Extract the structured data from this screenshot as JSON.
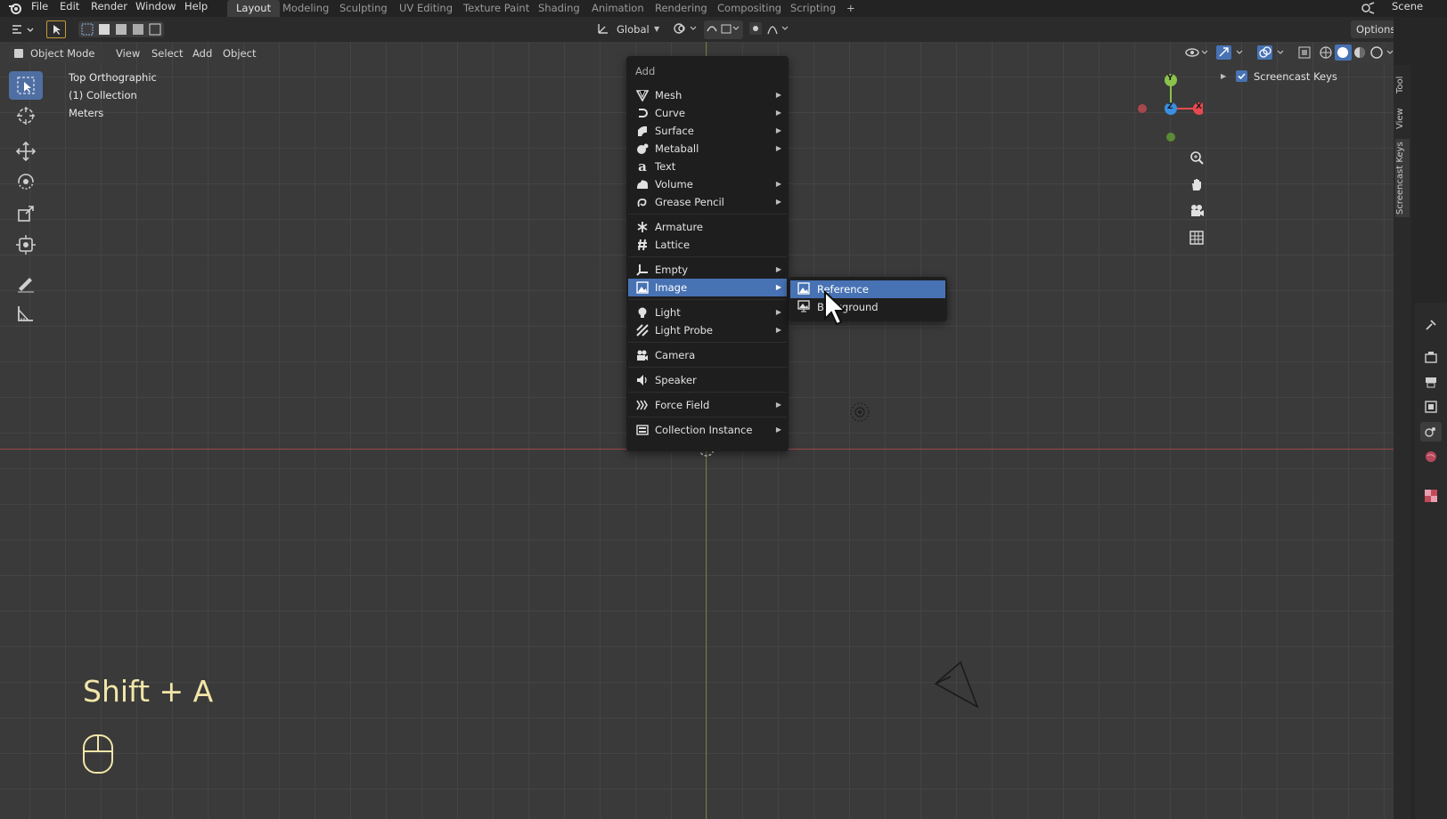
{
  "topbar": {
    "menus": [
      "File",
      "Edit",
      "Render",
      "Window",
      "Help"
    ],
    "workspaces": [
      "Layout",
      "Modeling",
      "Sculpting",
      "UV Editing",
      "Texture Paint",
      "Shading",
      "Animation",
      "Rendering",
      "Compositing",
      "Scripting"
    ],
    "active_workspace": "Layout",
    "add_tab": "+",
    "scene": "Scene"
  },
  "toolheader": {
    "transform_orientation": "Global",
    "options": "Options"
  },
  "viewheader": {
    "mode": "Object Mode",
    "view": "View",
    "select": "Select",
    "add": "Add",
    "object": "Object"
  },
  "viewport": {
    "view_name": "Top Orthographic",
    "collection": "(1) Collection",
    "units": "Meters"
  },
  "gizmo": {
    "y": "Y",
    "z": "Z",
    "x": "X"
  },
  "add_menu": {
    "title": "Add",
    "items": [
      {
        "label": "Mesh",
        "icon": "mesh-icon",
        "submenu": true
      },
      {
        "label": "Curve",
        "icon": "curve-icon",
        "submenu": true
      },
      {
        "label": "Surface",
        "icon": "surface-icon",
        "submenu": true
      },
      {
        "label": "Metaball",
        "icon": "metaball-icon",
        "submenu": true
      },
      {
        "label": "Text",
        "icon": "text-icon",
        "submenu": false
      },
      {
        "label": "Volume",
        "icon": "volume-icon",
        "submenu": true
      },
      {
        "label": "Grease Pencil",
        "icon": "grease-pencil-icon",
        "submenu": true
      },
      {
        "label": "Armature",
        "icon": "armature-icon",
        "submenu": false
      },
      {
        "label": "Lattice",
        "icon": "lattice-icon",
        "submenu": false
      },
      {
        "label": "Empty",
        "icon": "empty-icon",
        "submenu": true
      },
      {
        "label": "Image",
        "icon": "image-icon",
        "submenu": true
      },
      {
        "label": "Light",
        "icon": "light-icon",
        "submenu": true
      },
      {
        "label": "Light Probe",
        "icon": "light-probe-icon",
        "submenu": true
      },
      {
        "label": "Camera",
        "icon": "camera-icon",
        "submenu": false
      },
      {
        "label": "Speaker",
        "icon": "speaker-icon",
        "submenu": false
      },
      {
        "label": "Force Field",
        "icon": "force-field-icon",
        "submenu": true
      },
      {
        "label": "Collection Instance",
        "icon": "collection-instance-icon",
        "submenu": true
      }
    ],
    "highlighted": "Image"
  },
  "image_submenu": {
    "items": [
      {
        "label": "Reference",
        "icon": "reference-image-icon"
      },
      {
        "label": "Background",
        "icon": "background-image-icon"
      }
    ],
    "highlighted": "Reference"
  },
  "screencast": {
    "keys": "Shift + A"
  },
  "right_panel": {
    "screencast_keys_label": "Screencast Keys",
    "tabs": [
      "Tool",
      "View",
      "Screencast Keys"
    ]
  },
  "colors": {
    "accent": "#4772b3",
    "x_axis": "#e8484f",
    "y_axis": "#8bc24a",
    "z_axis": "#3a8fe0",
    "screencast_text": "#f2e6a8"
  }
}
